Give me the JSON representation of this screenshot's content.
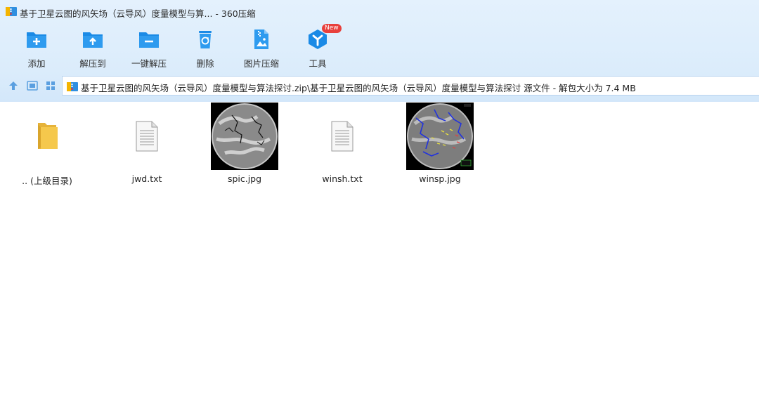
{
  "window": {
    "title": "基于卫星云图的风矢场（云导风）度量模型与算... - 360压缩"
  },
  "toolbar": {
    "items": [
      {
        "label": "添加",
        "icon": "add-to-archive-icon"
      },
      {
        "label": "解压到",
        "icon": "extract-to-icon"
      },
      {
        "label": "一键解压",
        "icon": "one-click-extract-icon"
      },
      {
        "label": "删除",
        "icon": "delete-icon"
      },
      {
        "label": "图片压缩",
        "icon": "image-compress-icon"
      },
      {
        "label": "工具",
        "icon": "tools-icon",
        "badge": "New"
      }
    ]
  },
  "nav": {
    "address": "基于卫星云图的风矢场（云导风）度量模型与算法探讨.zip\\基于卫星云图的风矢场（云导风）度量模型与算法探讨 源文件 - 解包大小为 7.4 MB"
  },
  "files": [
    {
      "name": ".. (上级目录)",
      "type": "parent-folder"
    },
    {
      "name": "jwd.txt",
      "type": "text"
    },
    {
      "name": "spic.jpg",
      "type": "image"
    },
    {
      "name": "winsh.txt",
      "type": "text"
    },
    {
      "name": "winsp.jpg",
      "type": "image"
    }
  ],
  "colors": {
    "chrome_bg": "#dbecfb",
    "icon_blue": "#1a8ae6",
    "badge_red": "#e8403c",
    "folder_yellow": "#f5c84c"
  }
}
